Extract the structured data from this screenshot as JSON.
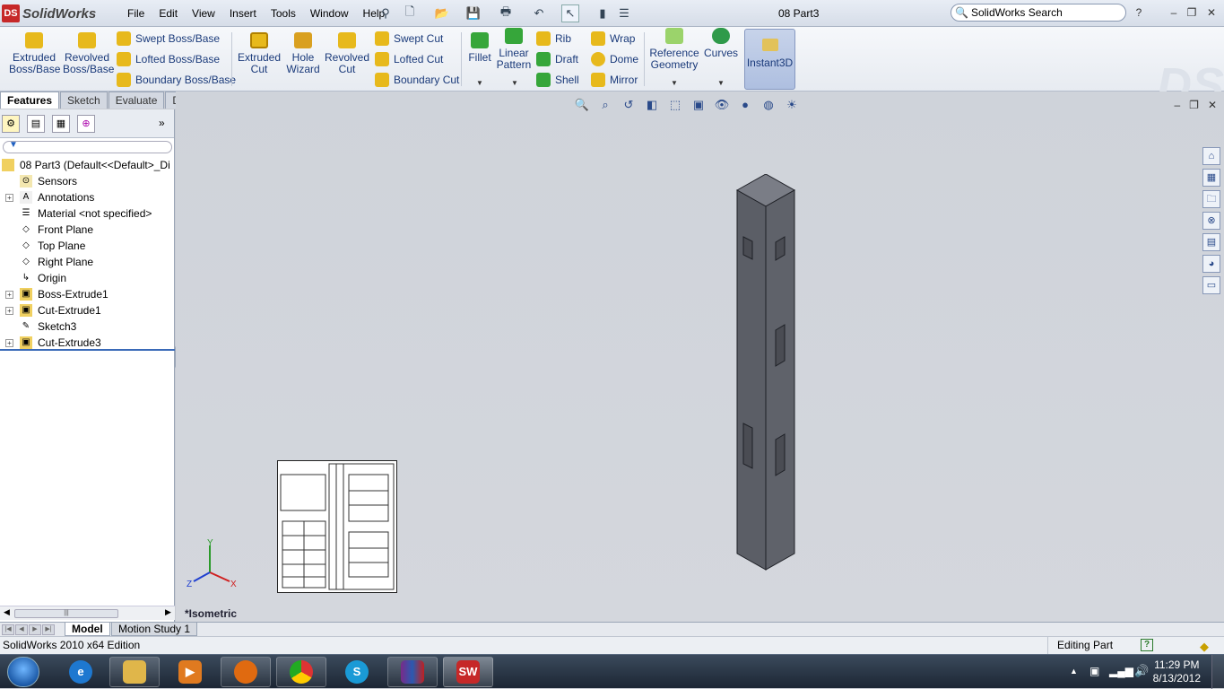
{
  "app": {
    "name": "SolidWorks",
    "document_title": "08 Part3"
  },
  "menu": [
    "File",
    "Edit",
    "View",
    "Insert",
    "Tools",
    "Window",
    "Help"
  ],
  "search": {
    "label": "SolidWorks Search"
  },
  "ribbon": {
    "extruded_boss": "Extruded Boss/Base",
    "revolved_boss": "Revolved Boss/Base",
    "swept_boss": "Swept Boss/Base",
    "lofted_boss": "Lofted Boss/Base",
    "boundary_boss": "Boundary Boss/Base",
    "extruded_cut": "Extruded Cut",
    "hole_wizard": "Hole Wizard",
    "revolved_cut": "Revolved Cut",
    "swept_cut": "Swept Cut",
    "lofted_cut": "Lofted Cut",
    "boundary_cut": "Boundary Cut",
    "fillet": "Fillet",
    "linear_pattern": "Linear Pattern",
    "rib": "Rib",
    "draft": "Draft",
    "shell": "Shell",
    "wrap": "Wrap",
    "dome": "Dome",
    "mirror": "Mirror",
    "reference_geometry": "Reference Geometry",
    "curves": "Curves",
    "instant3d": "Instant3D"
  },
  "tabs": [
    "Features",
    "Sketch",
    "Evaluate",
    "DimXpert"
  ],
  "tree": {
    "root": "08 Part3  (Default<<Default>_Di",
    "items": [
      {
        "label": "Sensors",
        "icon": "sensor-icon",
        "expandable": false
      },
      {
        "label": "Annotations",
        "icon": "annotations-icon",
        "expandable": true
      },
      {
        "label": "Material <not specified>",
        "icon": "material-icon",
        "expandable": false
      },
      {
        "label": "Front Plane",
        "icon": "plane-icon",
        "expandable": false
      },
      {
        "label": "Top Plane",
        "icon": "plane-icon",
        "expandable": false
      },
      {
        "label": "Right Plane",
        "icon": "plane-icon",
        "expandable": false
      },
      {
        "label": "Origin",
        "icon": "origin-icon",
        "expandable": false
      },
      {
        "label": "Boss-Extrude1",
        "icon": "extrude-icon",
        "expandable": true
      },
      {
        "label": "Cut-Extrude1",
        "icon": "cut-icon",
        "expandable": true
      },
      {
        "label": "Sketch3",
        "icon": "sketch-icon",
        "expandable": false
      },
      {
        "label": "Cut-Extrude3",
        "icon": "cut-icon",
        "expandable": true
      }
    ]
  },
  "viewport": {
    "view_label": "*Isometric",
    "triad": {
      "x": "X",
      "y": "Y",
      "z": "Z"
    }
  },
  "model_tabs": [
    "Model",
    "Motion Study 1"
  ],
  "status": {
    "edition": "SolidWorks 2010 x64 Edition",
    "mode": "Editing Part"
  },
  "taskbar": {
    "apps": [
      "internet-explorer",
      "file-explorer",
      "media-player",
      "firefox",
      "chrome",
      "skype",
      "winrar",
      "solidworks"
    ],
    "time": "11:29 PM",
    "date": "8/13/2012"
  },
  "colors": {
    "accent": "#1a3a7a",
    "part_face": "#5b5e66",
    "part_top": "#7a7d86"
  }
}
